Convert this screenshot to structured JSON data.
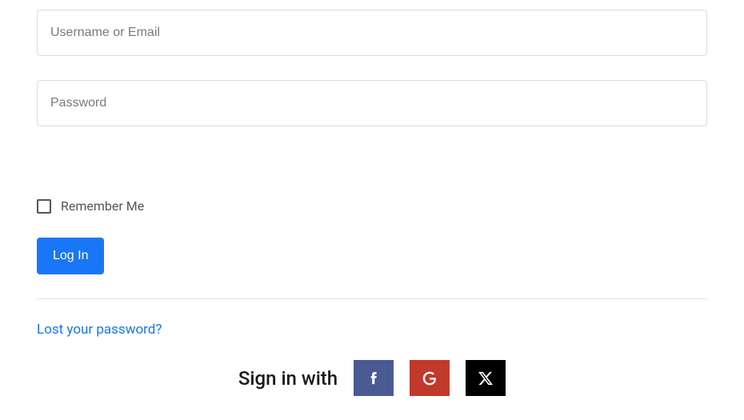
{
  "form": {
    "username_placeholder": "Username or Email",
    "password_placeholder": "Password",
    "remember_label": "Remember Me",
    "login_button_label": "Log In",
    "lost_password_label": "Lost your password?"
  },
  "social": {
    "label": "Sign in with",
    "providers": {
      "facebook": "Facebook",
      "google": "Google",
      "x": "X"
    }
  }
}
